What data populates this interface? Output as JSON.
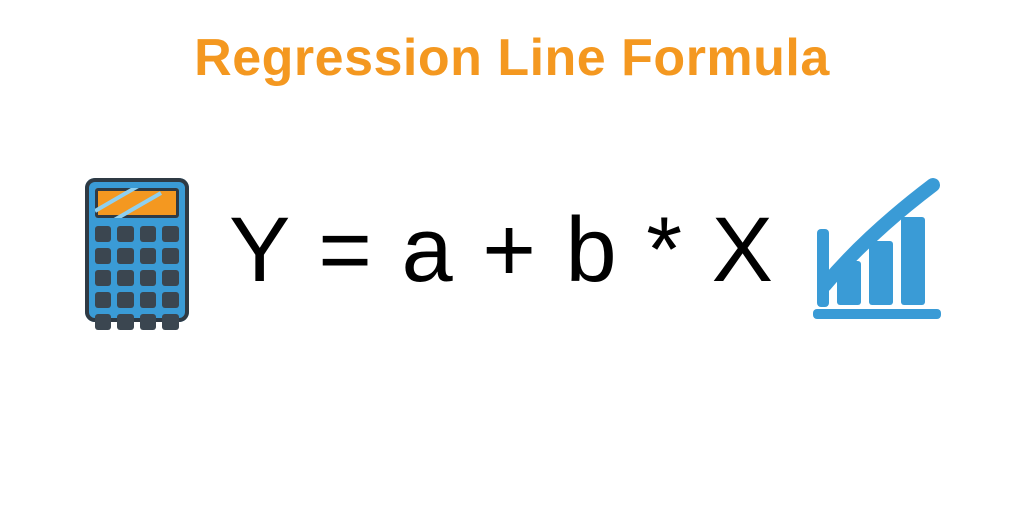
{
  "title": "Regression Line Formula",
  "formula": "Y  =  a + b  * X",
  "icons": {
    "left": "calculator-icon",
    "right": "growth-chart-icon"
  },
  "colors": {
    "title": "#f49820",
    "formula": "#000000",
    "chart_blue": "#3a9bd6",
    "calc_body": "#3a9bd6",
    "calc_dark": "#2f3a44",
    "calc_screen": "#f49820"
  }
}
